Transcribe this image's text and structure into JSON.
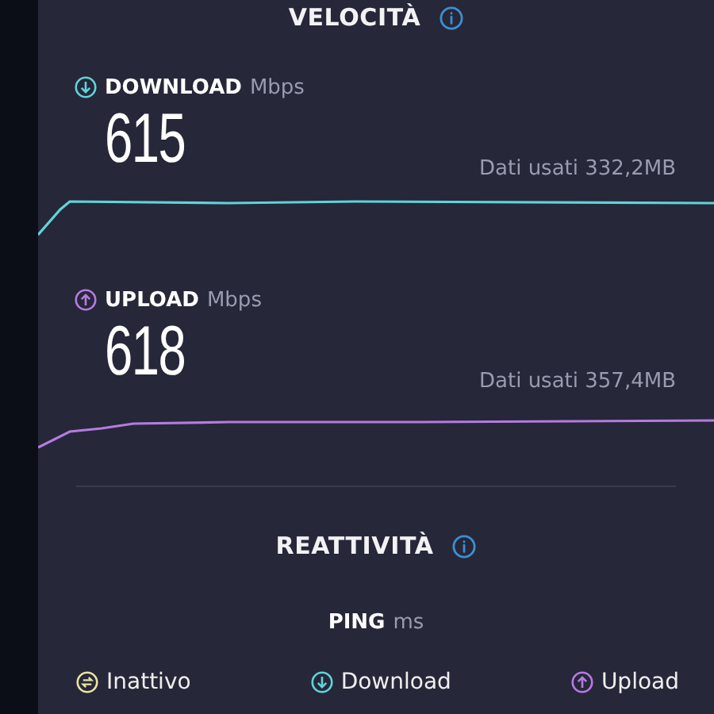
{
  "speed": {
    "title": "VELOCITÀ",
    "metrics": [
      {
        "kind": "download",
        "label": "DOWNLOAD",
        "unit": "Mbps",
        "value": "615",
        "data_used": "Dati usati 332,2MB",
        "color": "#5fd3d8"
      },
      {
        "kind": "upload",
        "label": "UPLOAD",
        "unit": "Mbps",
        "value": "618",
        "data_used": "Dati usati 357,4MB",
        "color": "#b57be0"
      }
    ]
  },
  "responsiveness": {
    "title": "REATTIVITÀ",
    "ping_label": "PING",
    "ping_unit": "ms",
    "legend": [
      {
        "kind": "idle",
        "label": "Inattivo",
        "color": "#e8e3a0"
      },
      {
        "kind": "download",
        "label": "Download",
        "color": "#5fd3d8"
      },
      {
        "kind": "upload",
        "label": "Upload",
        "color": "#b57be0"
      }
    ]
  }
}
